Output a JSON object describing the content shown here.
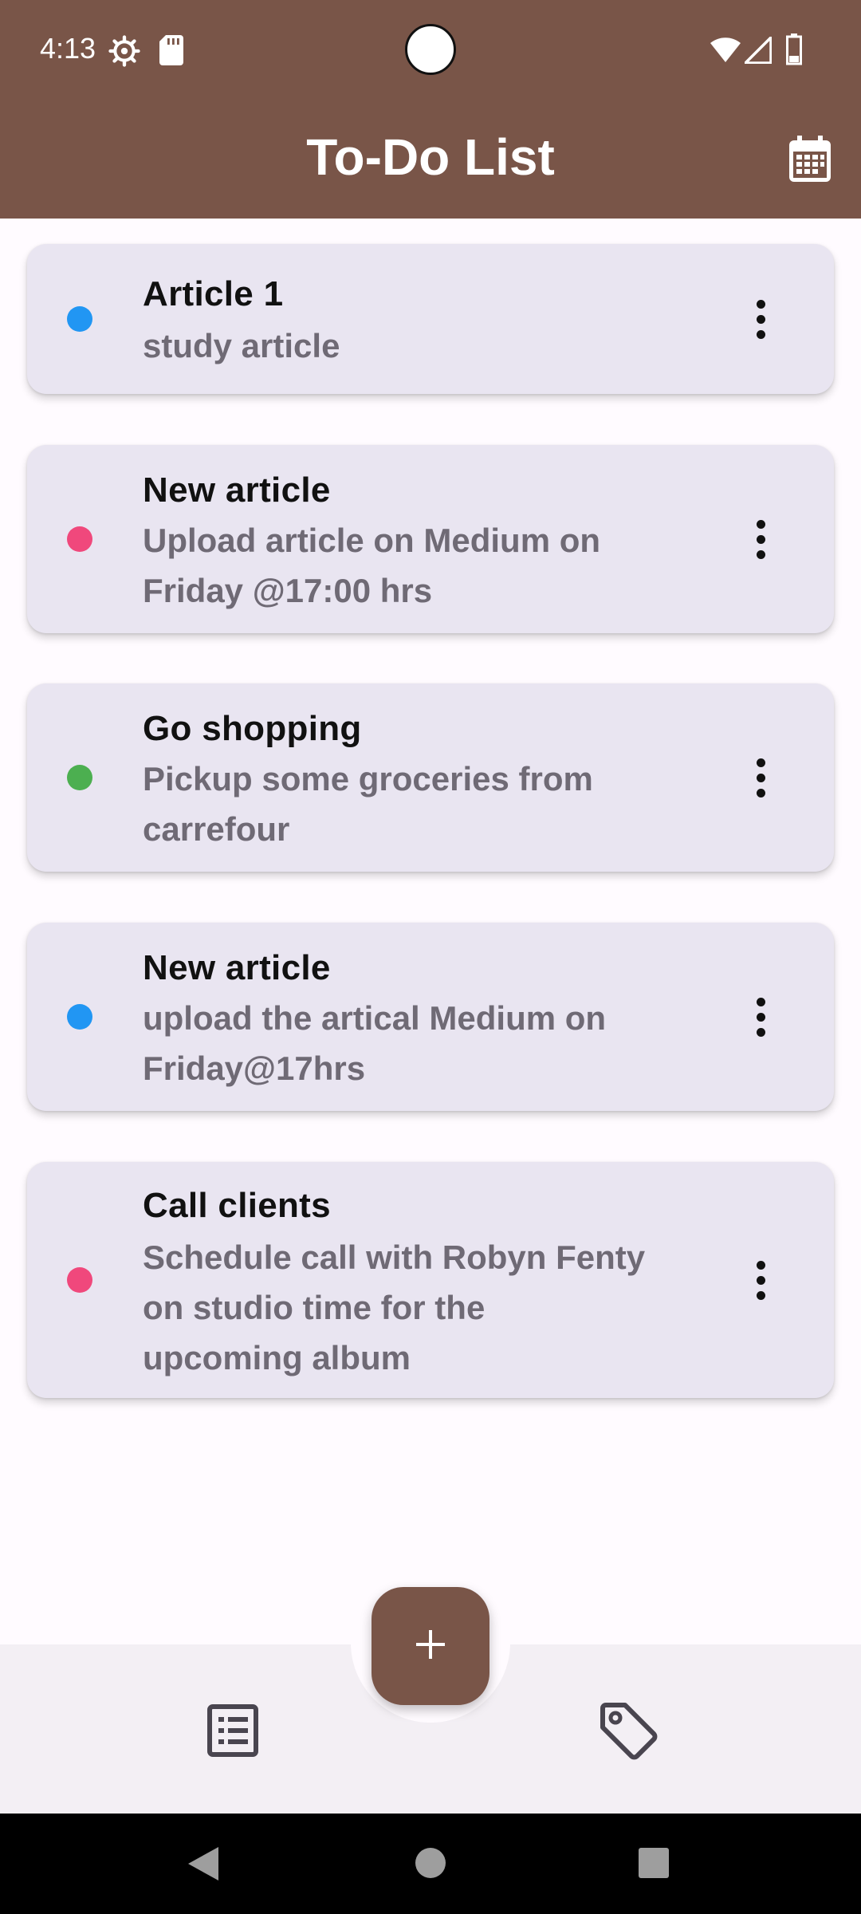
{
  "status_bar": {
    "time": "4:13",
    "icons": [
      "settings-gear-icon",
      "sd-card-icon",
      "wifi-icon",
      "signal-icon",
      "battery-icon"
    ]
  },
  "app_bar": {
    "title": "To-Do List",
    "action_icon": "calendar-icon",
    "color": "#795548"
  },
  "todos": [
    {
      "title": "Article 1",
      "description": "study article",
      "color": "#2196F3"
    },
    {
      "title": "New article",
      "description": "Upload article on Medium on Friday @17:00 hrs",
      "color": "#F0487C"
    },
    {
      "title": "Go shopping",
      "description": "Pickup some groceries from carrefour",
      "color": "#4CAF50"
    },
    {
      "title": "New article",
      "description": "upload the artical Medium on Friday@17hrs",
      "color": "#2196F3"
    },
    {
      "title": "Call clients",
      "description": "Schedule call with Robyn Fenty on studio time for the upcoming album",
      "color": "#F0487C"
    }
  ],
  "fab": {
    "icon": "plus-icon",
    "color": "#795548"
  },
  "bottom_nav": {
    "items": [
      {
        "icon": "list-icon"
      },
      {
        "icon": "tag-icon"
      }
    ]
  },
  "system_nav": [
    "back-icon",
    "home-icon",
    "recents-icon"
  ]
}
